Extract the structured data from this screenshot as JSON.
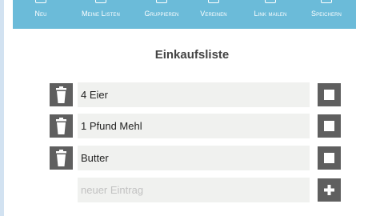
{
  "toolbar": {
    "items": [
      {
        "label": "Neu",
        "icon": "cart-icon"
      },
      {
        "label": "Meine Listen",
        "icon": "cart-icon"
      },
      {
        "label": "Gruppieren",
        "icon": "group-icon"
      },
      {
        "label": "Vereinen",
        "icon": "merge-icon"
      },
      {
        "label": "Link mailen",
        "icon": "mail-icon"
      },
      {
        "label": "Speichern",
        "icon": "save-icon"
      }
    ]
  },
  "list": {
    "title": "Einkaufsliste",
    "items": [
      {
        "text": "4 Eier",
        "checked": false
      },
      {
        "text": "1 Pfund Mehl",
        "checked": false
      },
      {
        "text": "Butter",
        "checked": false
      }
    ],
    "new_entry": {
      "placeholder": "neuer Eintrag",
      "value": ""
    }
  },
  "colors": {
    "toolbar": "#6bbbd9",
    "button": "#5f5f5f",
    "field": "#f0f1ef",
    "title": "#444444"
  }
}
